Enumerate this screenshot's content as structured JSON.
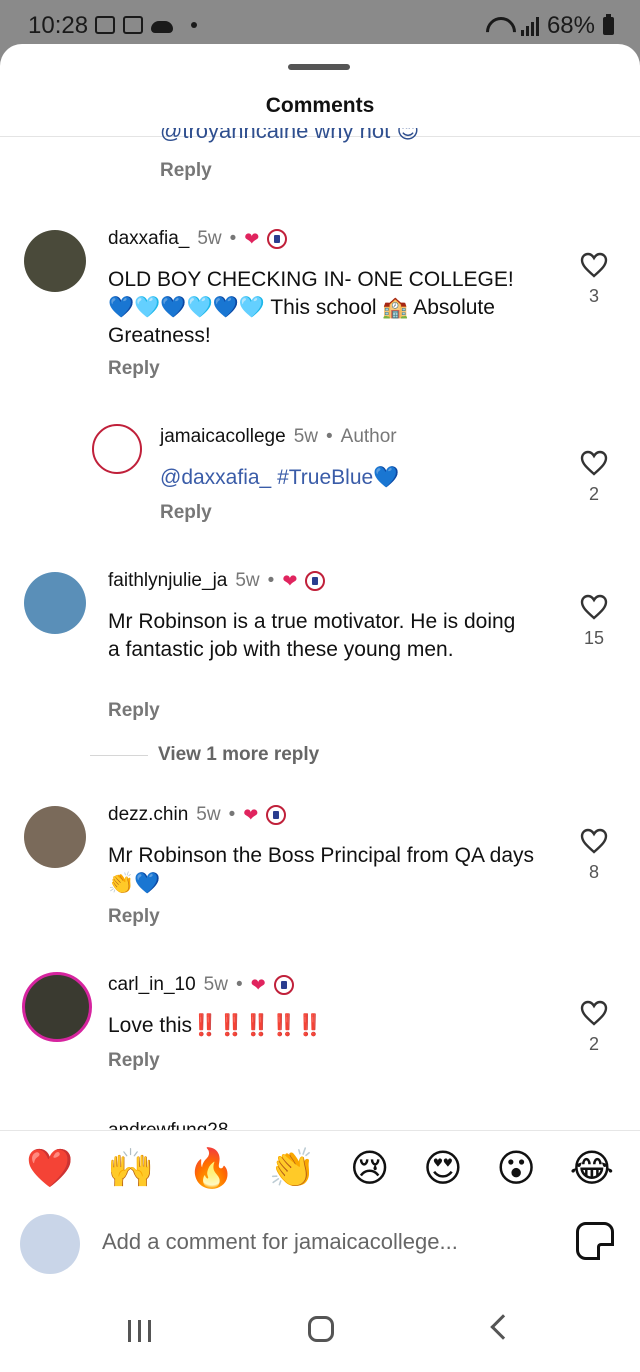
{
  "status_bar": {
    "time": "10:28",
    "battery": "68%"
  },
  "sheet": {
    "title": "Comments"
  },
  "partial_comment": {
    "text": "@troyanncaine why not 😊",
    "reply_label": "Reply"
  },
  "comments": [
    {
      "username": "daxxafia_",
      "age": "5w",
      "author_tag": "",
      "text": "OLD BOY CHECKING IN- ONE COLLEGE! 💙🩵💙🩵💙🩵 This school 🏫 Absolute Greatness!",
      "likes": "3",
      "reply_label": "Reply",
      "creator_liked": true
    },
    {
      "username": "jamaicacollege",
      "age": "5w",
      "author_tag": "Author",
      "mention": "@daxxafia_",
      "hashtag": "#TrueBlue💙",
      "text": "",
      "likes": "2",
      "reply_label": "Reply",
      "creator_liked": false
    },
    {
      "username": "faithlynjulie_ja",
      "age": "5w",
      "author_tag": "",
      "text": "Mr Robinson is a true motivator. He is doing a fantastic job with these young men.",
      "likes": "15",
      "reply_label": "Reply",
      "creator_liked": true
    },
    {
      "username": "dezz.chin",
      "age": "5w",
      "author_tag": "",
      "text": "Mr Robinson the Boss Principal from QA days 👏💙",
      "likes": "8",
      "reply_label": "Reply",
      "creator_liked": true
    },
    {
      "username": "carl_in_10",
      "age": "5w",
      "author_tag": "",
      "text": "Love this‼️‼️‼️‼️‼️",
      "likes": "2",
      "reply_label": "Reply",
      "creator_liked": true
    }
  ],
  "view_more_replies": "View 1 more reply",
  "peek_username": "andrewfung28",
  "emoji_bar": [
    "❤️",
    "🙌",
    "🔥",
    "👏",
    "😢",
    "😍",
    "😮",
    "😂"
  ],
  "composer": {
    "placeholder": "Add a comment for jamaicacollege..."
  },
  "colors": {
    "mention": "#3a5ca8",
    "heart": "#e0245e",
    "meta": "#777777"
  }
}
